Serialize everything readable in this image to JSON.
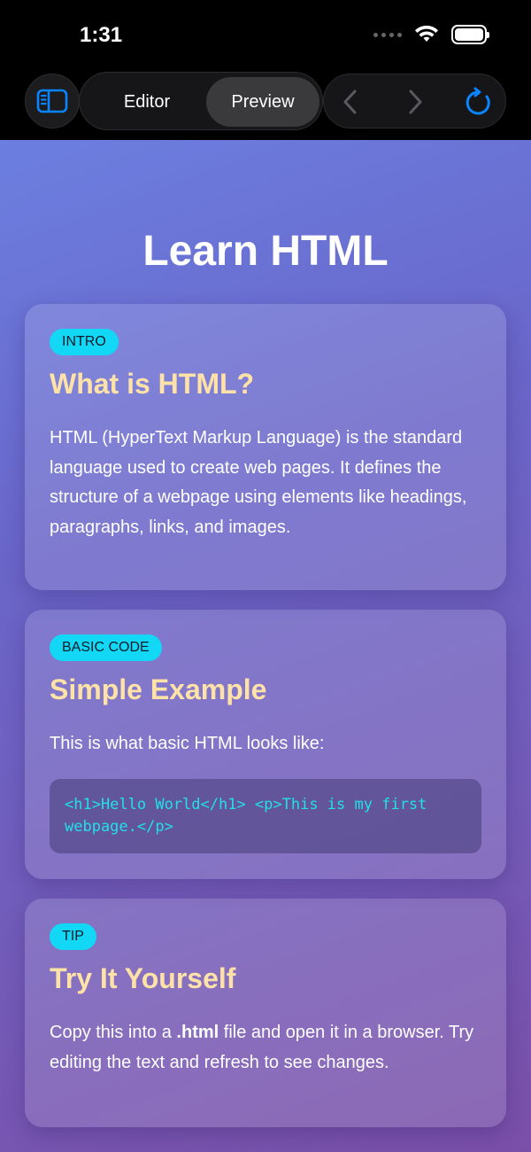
{
  "status_bar": {
    "time": "1:31"
  },
  "toolbar": {
    "editor_label": "Editor",
    "preview_label": "Preview",
    "active_tab": "Preview"
  },
  "page": {
    "title": "Learn HTML"
  },
  "cards": [
    {
      "badge": "INTRO",
      "title": "What is HTML?",
      "text": "HTML (HyperText Markup Language) is the standard language used to create web pages. It defines the structure of a webpage using elements like headings, paragraphs, links, and images."
    },
    {
      "badge": "BASIC CODE",
      "title": "Simple Example",
      "text": "This is what basic HTML looks like:",
      "code": "<h1>Hello World</h1> <p>This is my first webpage.</p>"
    },
    {
      "badge": "TIP",
      "title": "Try It Yourself",
      "text_before": "Copy this into a ",
      "text_bold": ".html",
      "text_after": " file and open it in a browser. Try editing the text and refresh to see changes."
    }
  ],
  "colors": {
    "accent": "#0a84ff",
    "badge": "#12d8f5",
    "card_title": "#ffe2a8",
    "code": "#22e0e8"
  },
  "icons": {
    "sidebar": "sidebar-icon",
    "back": "chevron-left-icon",
    "forward": "chevron-right-icon",
    "reload": "reload-icon"
  }
}
